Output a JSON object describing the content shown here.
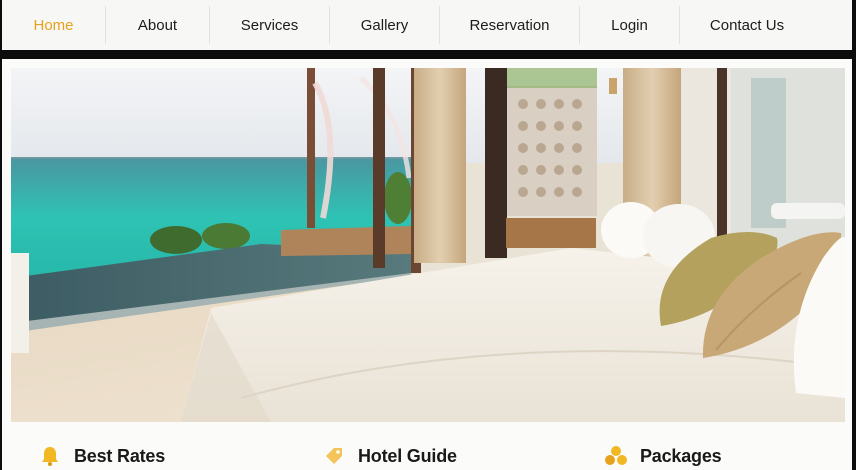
{
  "nav": {
    "items": [
      {
        "label": "Home",
        "active": true
      },
      {
        "label": "About"
      },
      {
        "label": "Services"
      },
      {
        "label": "Gallery"
      },
      {
        "label": "Reservation"
      },
      {
        "label": "Login"
      },
      {
        "label": "Contact Us"
      }
    ],
    "active_color": "#e6a11d"
  },
  "hero": {
    "image": "hotel-bedroom-ocean-view"
  },
  "features": [
    {
      "title": "Best Rates",
      "icon": "bell-icon"
    },
    {
      "title": "Hotel Guide",
      "icon": "tag-icon"
    },
    {
      "title": "Packages",
      "icon": "coins-icon"
    }
  ]
}
